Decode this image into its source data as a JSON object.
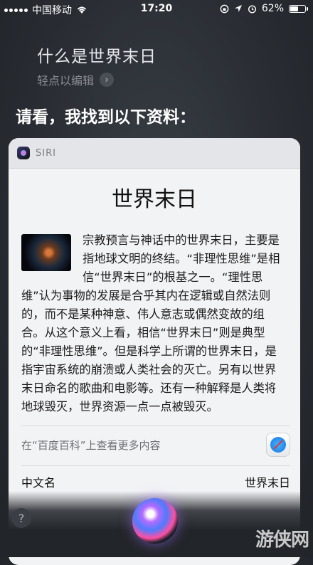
{
  "status_bar": {
    "carrier": "中国移动",
    "time": "17:20",
    "battery": "62%",
    "battery_level": 0.62,
    "icons": [
      "signal-icon",
      "wifi-icon",
      "lock-rotation-icon",
      "location-icon",
      "alarm-icon",
      "battery-icon"
    ]
  },
  "siri": {
    "query": "什么是世界末日",
    "edit_hint": "轻点以编辑",
    "answer_intro": "请看，我找到以下资料："
  },
  "card": {
    "brand": "SIRI",
    "title": "世界末日",
    "article": "宗教预言与神话中的世界末日，主要是指地球文明的终结。“非理性思维”是相信“世界末日”的根基之一。“理性思维”认为事物的发展是合乎其内在逻辑或自然法则的，而不是某种神意、伟人意志或偶然变故的组合。从这个意义上看，相信“世界末日”则是典型的“非理性思维”。但是科学上所谓的世界末日，是指宇宙系统的崩溃或人类社会的灭亡。另有以世界末日命名的歌曲和电影等。还有一种解释是人类将地球毁灭，世界资源一点一点被毁灭。",
    "more_link": "在“百度百科”上查看更多内容",
    "info_label": "中文名",
    "info_value": "世界末日"
  },
  "bottom": {
    "help": "?",
    "watermark": "游侠网"
  }
}
